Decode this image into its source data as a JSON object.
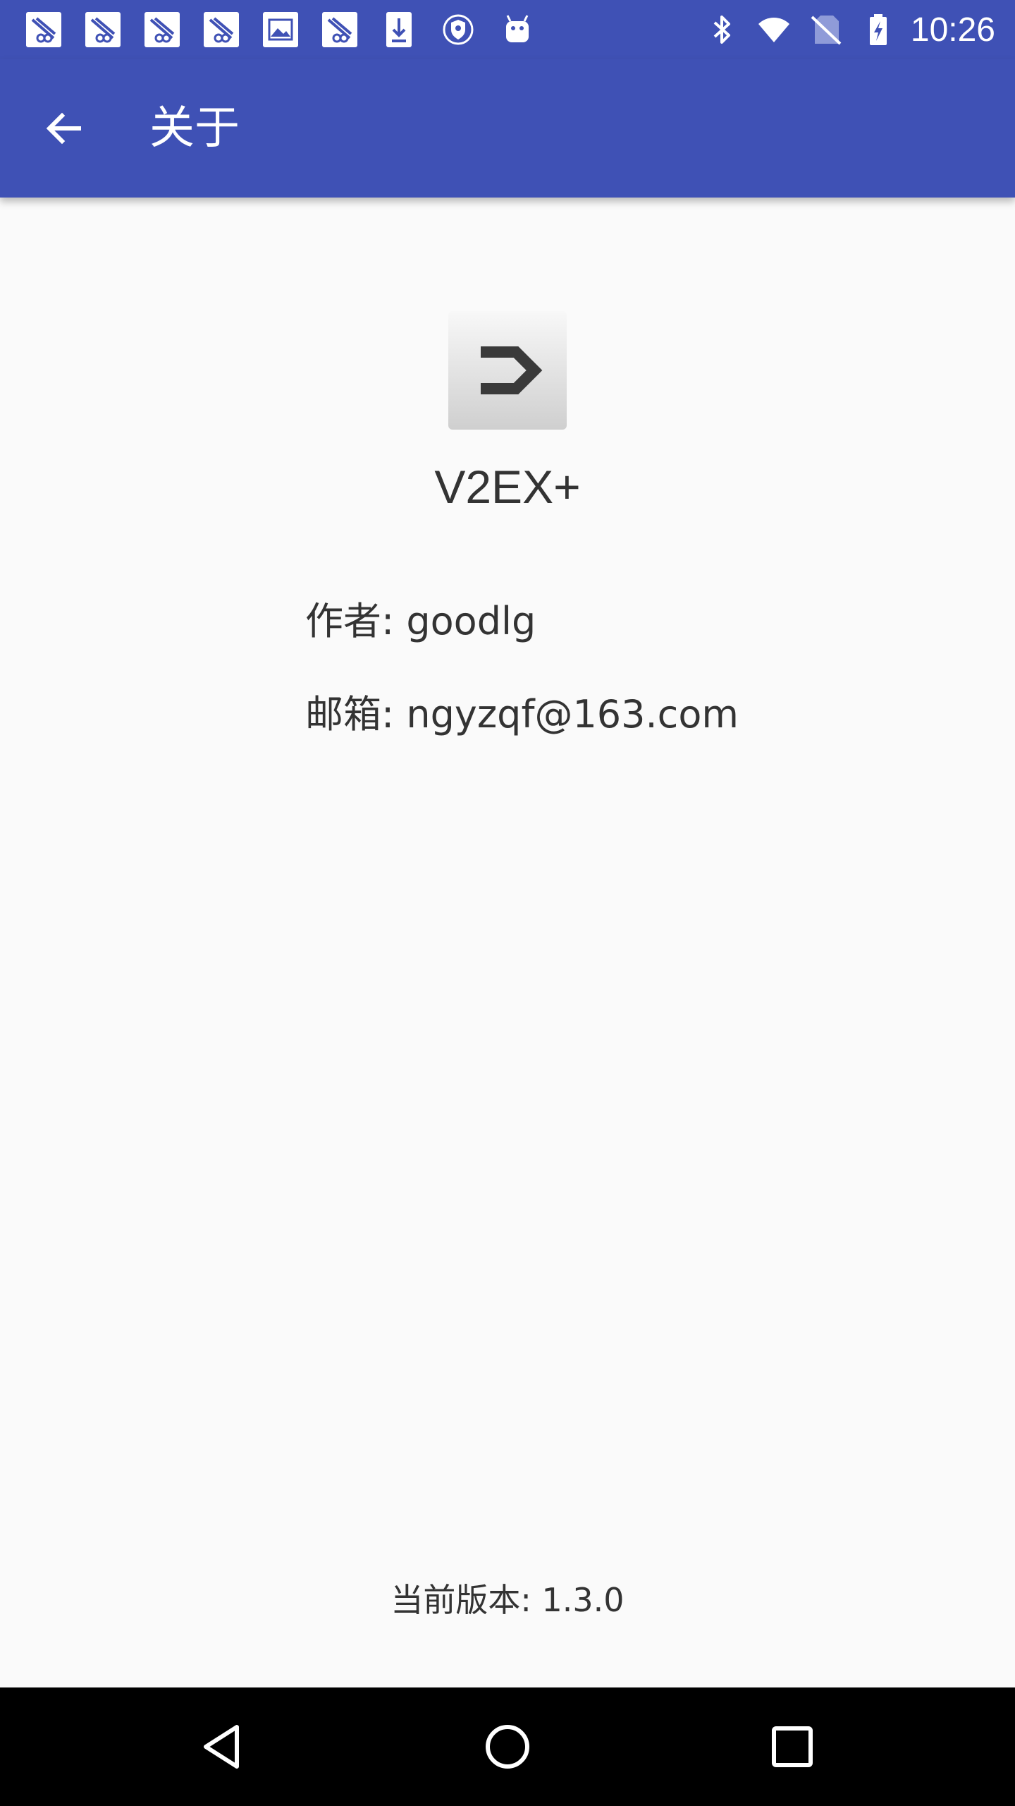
{
  "status_bar": {
    "time": "10:26",
    "notification_icons": [
      "notification-app-icon",
      "notification-app-icon",
      "notification-app-icon",
      "notification-app-icon",
      "image-icon",
      "notification-app-icon",
      "download-icon",
      "vpn-shield-icon",
      "android-icon"
    ],
    "system_icons": [
      "bluetooth-icon",
      "wifi-icon",
      "no-sim-icon",
      "battery-charging-icon"
    ]
  },
  "app_bar": {
    "title": "关于",
    "back_icon": "arrow-back-icon",
    "background": "#3f51b5"
  },
  "about": {
    "app_name": "V2EX+",
    "author": "作者: goodlg",
    "email": "邮箱: ngyzqf@163.com",
    "version": "当前版本: 1.3.0"
  },
  "nav_bar": {
    "buttons": [
      "nav-back-icon",
      "nav-home-icon",
      "nav-recents-icon"
    ]
  }
}
